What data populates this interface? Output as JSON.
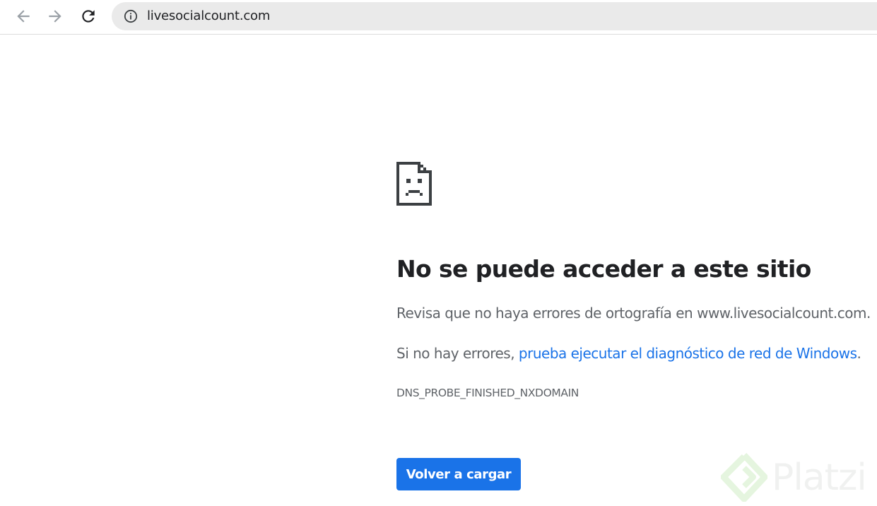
{
  "browser": {
    "url": "livesocialcount.com",
    "icons": {
      "back": "arrow-left-icon",
      "forward": "arrow-right-icon",
      "reload": "reload-icon",
      "site_info": "info-circle-icon"
    }
  },
  "error_page": {
    "icon": "sad-page-icon",
    "heading": "No se puede acceder a este sitio",
    "suggestion": "Revisa que no haya errores de ortografía en www.livesocialcount.com.",
    "diagnostic_prefix": "Si no hay errores, ",
    "diagnostic_link": "prueba ejecutar el diagnóstico de red de Windows",
    "diagnostic_suffix": ".",
    "error_code": "DNS_PROBE_FINISHED_NXDOMAIN",
    "reload_button": "Volver a cargar"
  },
  "watermark": {
    "text": "Platzi"
  },
  "colors": {
    "accent": "#1a73e8",
    "heading_text": "#202124",
    "body_text": "#5f6368",
    "omnibox_bg": "#eaeaea"
  }
}
